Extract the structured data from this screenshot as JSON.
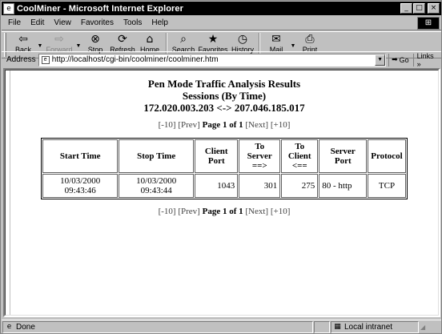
{
  "window": {
    "title": "CoolMiner - Microsoft Internet Explorer",
    "app_icon": "ie-page-icon",
    "controls": {
      "minimize": "_",
      "maximize": "□",
      "close": "×"
    }
  },
  "menubar": {
    "items": [
      "File",
      "Edit",
      "View",
      "Favorites",
      "Tools",
      "Help"
    ],
    "throbber": "⊞"
  },
  "toolbar": {
    "buttons": [
      {
        "label": "Back",
        "icon": "back-arrow-icon",
        "glyph": "⇦",
        "enabled": true,
        "dropdown": true
      },
      {
        "label": "Forward",
        "icon": "forward-arrow-icon",
        "glyph": "⇨",
        "enabled": false,
        "dropdown": true
      },
      {
        "label": "Stop",
        "icon": "stop-icon",
        "glyph": "⊗",
        "enabled": true
      },
      {
        "label": "Refresh",
        "icon": "refresh-icon",
        "glyph": "⟳",
        "enabled": true
      },
      {
        "label": "Home",
        "icon": "home-icon",
        "glyph": "⌂",
        "enabled": true
      },
      {
        "label": "Search",
        "icon": "search-icon",
        "glyph": "⌕",
        "enabled": true
      },
      {
        "label": "Favorites",
        "icon": "favorites-icon",
        "glyph": "★",
        "enabled": true
      },
      {
        "label": "History",
        "icon": "history-icon",
        "glyph": "◷",
        "enabled": true
      },
      {
        "label": "Mail",
        "icon": "mail-icon",
        "glyph": "✉",
        "enabled": true,
        "dropdown": true
      },
      {
        "label": "Print",
        "icon": "print-icon",
        "glyph": "⎙",
        "enabled": true
      }
    ]
  },
  "addressbar": {
    "label": "Address",
    "value": "http://localhost/cgi-bin/coolminer/coolminer.htm",
    "go_label": "Go",
    "links_label": "Links »"
  },
  "report": {
    "title_line1": "Pen Mode Traffic Analysis Results",
    "title_line2": "Sessions (By Time)",
    "title_line3": "172.020.003.203 <-> 207.046.185.017",
    "pager": {
      "first": "[-10]",
      "prev": "[Prev]",
      "current": "Page 1 of 1",
      "next": "[Next]",
      "last": "[+10]"
    },
    "table": {
      "headers": [
        "Start Time",
        "Stop Time",
        "Client Port",
        "To Server\n==>",
        "To Client\n<==",
        "Server Port",
        "Protocol"
      ],
      "rows": [
        [
          "10/03/2000 09:43:46",
          "10/03/2000 09:43:44",
          "1043",
          "301",
          "275",
          "80 - http",
          "TCP"
        ]
      ]
    }
  },
  "statusbar": {
    "status_text": "Done",
    "zone_text": "Local intranet"
  }
}
